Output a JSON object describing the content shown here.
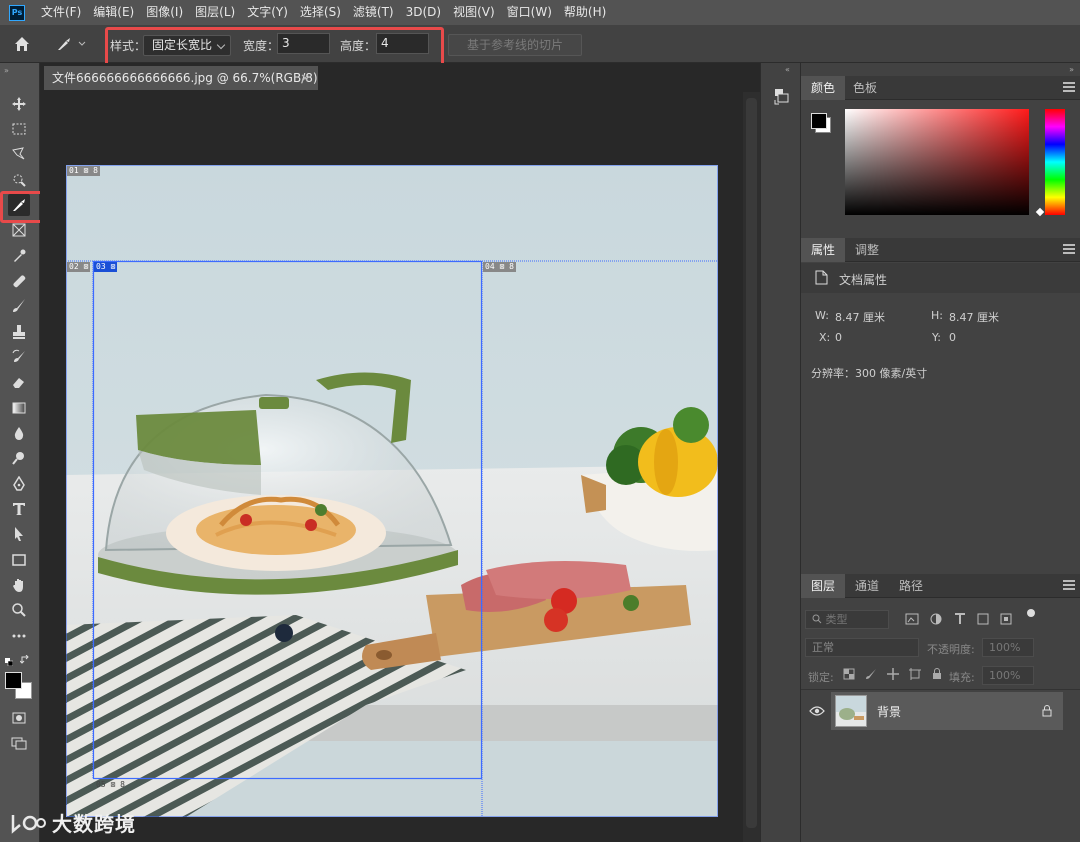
{
  "app": {
    "logo": "Ps"
  },
  "menu": [
    "文件(F)",
    "编辑(E)",
    "图像(I)",
    "图层(L)",
    "文字(Y)",
    "选择(S)",
    "滤镜(T)",
    "3D(D)",
    "视图(V)",
    "窗口(W)",
    "帮助(H)"
  ],
  "options": {
    "style_label": "样式：",
    "style_value": "固定长宽比",
    "width_label": "宽度：",
    "width_value": "3",
    "height_label": "高度：",
    "height_value": "4",
    "guide_slice_button": "基于参考线的切片"
  },
  "document": {
    "tab_title": "文件666666666666666.jpg @ 66.7%(RGB/8) *",
    "close": "×"
  },
  "slices": [
    {
      "label": "01"
    },
    {
      "label": "02"
    },
    {
      "label": "03"
    },
    {
      "label": "04"
    },
    {
      "label": "05"
    }
  ],
  "color_panel": {
    "tabs": [
      "颜色",
      "色板"
    ]
  },
  "properties_panel": {
    "tabs": [
      "属性",
      "调整"
    ],
    "doc_props": "文档属性",
    "w_label": "W:",
    "w_value": "8.47 厘米",
    "h_label": "H:",
    "h_value": "8.47 厘米",
    "x_label": "X:",
    "x_value": "0",
    "y_label": "Y:",
    "y_value": "0",
    "resolution": "分辨率：300 像素/英寸"
  },
  "layers_panel": {
    "tabs": [
      "图层",
      "通道",
      "路径"
    ],
    "filter_kind": "类型",
    "blend_mode": "正常",
    "opacity_label": "不透明度:",
    "opacity_value": "100%",
    "lock_label": "锁定:",
    "fill_label": "填充:",
    "fill_value": "100%",
    "layer_name": "背景"
  },
  "watermark": "大数跨境",
  "colors": {
    "highlight": "#e84a4a",
    "slice_line": "#3d6bff",
    "panel_bg": "#424242",
    "menubar_bg": "#535353"
  }
}
